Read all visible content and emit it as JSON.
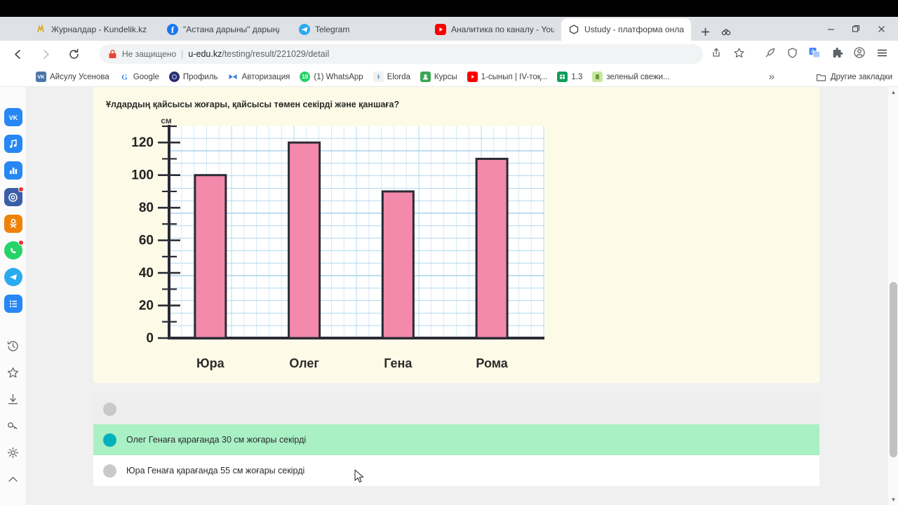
{
  "browser": {
    "tabs": [
      {
        "title": "Журналдар - Kundelik.kz",
        "icon": "kundelik-favicon",
        "color": "#f5d13b",
        "active": false
      },
      {
        "title": "\"Астана дарыны\" дарындыл",
        "icon": "facebook-favicon",
        "color": "#1877f2",
        "active": false
      },
      {
        "title": "Telegram",
        "icon": "telegram-favicon",
        "color": "#2aabee",
        "active": false
      },
      {
        "title": "Аналитика по каналу - YouT",
        "icon": "youtube-favicon",
        "color": "#ff0000",
        "active": false
      },
      {
        "title": "Ustudy - платформа онлайн",
        "icon": "ustudy-favicon",
        "color": "#ffffff",
        "active": true
      }
    ],
    "new_tab_label": "+",
    "tab_search_label": "tab-search",
    "window_controls": {
      "minimize": "—",
      "maximize": "❐",
      "close": "✕"
    },
    "omnibox": {
      "security_label": "Не защищено",
      "lock_icon": "insecure-lock-icon",
      "url_host": "u-edu.kz",
      "url_path": "/testing/result/221029/detail"
    },
    "nav": {
      "back": "back-icon",
      "forward": "forward-icon",
      "reload": "reload-icon"
    },
    "toolbar_icons": [
      "share-icon",
      "bookmark-star-icon",
      "rocket-icon",
      "shield-icon",
      "translate-icon",
      "extensions-icon",
      "profile-icon",
      "menu-icon"
    ],
    "bookmarks": [
      {
        "label": "Айсулу Усенова",
        "icon": "vk-icon",
        "color": "#4a76a8"
      },
      {
        "label": "Google",
        "icon": "google-icon",
        "color": "#ffffff"
      },
      {
        "label": "Профиль",
        "icon": "profile-circle-icon",
        "color": "#2b2b6b"
      },
      {
        "label": "Авторизация",
        "icon": "butterfly-icon",
        "color": "#3b7be0"
      },
      {
        "label": "(1) WhatsApp",
        "icon": "whatsapp-green-icon",
        "color": "#25d366"
      },
      {
        "label": "Elorda",
        "icon": "elorda-icon",
        "color": "#eeeeee"
      },
      {
        "label": "Курсы",
        "icon": "contact-icon",
        "color": "#3aa655"
      },
      {
        "label": "1-сынып | IV-тоқ...",
        "icon": "youtube-icon",
        "color": "#ff0000"
      },
      {
        "label": "1.3",
        "icon": "sheets-icon",
        "color": "#0f9d58"
      },
      {
        "label": "зеленый свежи...",
        "icon": "note-icon",
        "color": "#c8e6a0"
      }
    ],
    "bookmarks_overflow": "»",
    "other_bookmarks": {
      "label": "Другие закладки",
      "icon": "folder-icon"
    }
  },
  "sidebar": {
    "items": [
      {
        "name": "vk",
        "icon": "vk-icon",
        "color": "#2787f5",
        "glyph": "VK",
        "badge": false
      },
      {
        "name": "vk-music",
        "icon": "music-note-icon",
        "color": "#2787f5",
        "glyph": "♪",
        "badge": false
      },
      {
        "name": "vk-stats",
        "icon": "bar-chart-icon",
        "color": "#2787f5",
        "glyph": "▥",
        "badge": false
      },
      {
        "name": "mail-ru",
        "icon": "mail-at-icon",
        "color": "#3a5fa8",
        "glyph": "@",
        "badge": true
      },
      {
        "name": "odnoklassniki",
        "icon": "ok-icon",
        "color": "#ee8208",
        "glyph": "OK",
        "badge": false
      },
      {
        "name": "whatsapp",
        "icon": "whatsapp-icon",
        "color": "#25d366",
        "glyph": "✆",
        "badge": true
      },
      {
        "name": "telegram",
        "icon": "telegram-icon",
        "color": "#2aabee",
        "glyph": "➤",
        "badge": false
      },
      {
        "name": "feed-list",
        "icon": "list-icon",
        "color": "#2787f5",
        "glyph": "☰",
        "badge": false
      }
    ],
    "tools": [
      {
        "name": "history",
        "icon": "history-icon"
      },
      {
        "name": "favorites",
        "icon": "star-outline-icon"
      },
      {
        "name": "downloads",
        "icon": "download-icon"
      },
      {
        "name": "passwords",
        "icon": "key-icon"
      },
      {
        "name": "settings",
        "icon": "gear-icon"
      },
      {
        "name": "collapse",
        "icon": "chevron-up-icon"
      }
    ]
  },
  "page": {
    "question": "Ұлдардың қайсысы жоғары, қайсысы төмен секірді және қаншаға?",
    "answers": [
      {
        "text": "",
        "selected": false,
        "style": "blank"
      },
      {
        "text": "Олег Генаға қарағанда 30 см жоғары секірді",
        "selected": true,
        "style": "selected"
      },
      {
        "text": "Юра Генаға қарағанда 55 см жоғары секірді",
        "selected": false,
        "style": "normal"
      }
    ],
    "colors": {
      "card_bg": "#fdfbe8",
      "selected_row": "#a9f0c5",
      "selected_radio": "#00b0ba",
      "unselected_radio": "#c9c9c9",
      "bar_fill": "#f389ab",
      "bar_stroke": "#2b2b35",
      "grid": "#8fc8e8"
    }
  },
  "chart_data": {
    "type": "bar",
    "title": "",
    "categories": [
      "Юра",
      "Олег",
      "Гена",
      "Рома"
    ],
    "values": [
      100,
      120,
      90,
      110
    ],
    "ylabel": "см",
    "xlabel": "",
    "ylim": [
      0,
      130
    ],
    "yticks": [
      0,
      20,
      40,
      60,
      80,
      100,
      120
    ],
    "ytick_labels": [
      "0",
      "20",
      "40",
      "60",
      "80",
      "100",
      "120"
    ],
    "minor_tick_step": 10,
    "grid": true,
    "legend": false,
    "bar_color": "#f389ab",
    "bar_edge_color": "#2b2b35"
  }
}
